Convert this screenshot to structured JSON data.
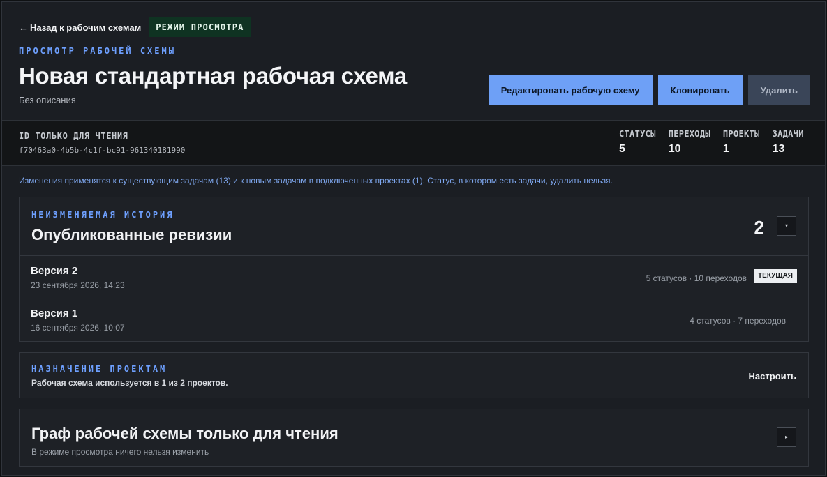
{
  "header": {
    "back_label": "Назад к рабочим схемам",
    "back_arrow": "←",
    "mode_badge": "РЕЖИМ ПРОСМОТРА",
    "eyebrow": "ПРОСМОТР РАБОЧЕЙ СХЕМЫ",
    "title": "Новая стандартная рабочая схема",
    "description": "Без описания",
    "actions": {
      "edit": "Редактировать рабочую схему",
      "clone": "Клонировать",
      "delete": "Удалить"
    }
  },
  "id_bar": {
    "label": "ID ТОЛЬКО ДЛЯ ЧТЕНИЯ",
    "value": "f70463a0-4b5b-4c1f-bc91-961340181990",
    "stats": [
      {
        "label": "СТАТУСЫ",
        "value": "5"
      },
      {
        "label": "ПЕРЕХОДЫ",
        "value": "10"
      },
      {
        "label": "ПРОЕКТЫ",
        "value": "1"
      },
      {
        "label": "ЗАДАЧИ",
        "value": "13"
      }
    ]
  },
  "notice": "Изменения применятся к существующим задачам (13) и к новым задачам в подключенных проектах (1). Статус, в котором есть задачи, удалить нельзя.",
  "revisions": {
    "eyebrow": "НЕИЗМЕНЯЕМАЯ ИСТОРИЯ",
    "title": "Опубликованные ревизии",
    "count": "2",
    "toggle_glyph": "▾",
    "items": [
      {
        "name": "Версия 2",
        "date": "23 сентября 2026, 14:23",
        "meta": "5 статусов · 10 переходов",
        "badge": "ТЕКУЩАЯ"
      },
      {
        "name": "Версия 1",
        "date": "16 сентября 2026, 10:07",
        "meta": "4 статусов · 7 переходов"
      }
    ]
  },
  "assignment": {
    "eyebrow": "НАЗНАЧЕНИЕ ПРОЕКТАМ",
    "text": "Рабочая схема используется в 1 из 2 проектов.",
    "action": "Настроить"
  },
  "graph": {
    "title": "Граф рабочей схемы только для чтения",
    "description": "В режиме просмотра ничего нельзя изменить",
    "toggle_glyph": "▸"
  },
  "colors": {
    "accent": "#6ea0f6",
    "eyebrow": "#6ea0ff",
    "badge_bg": "#0f3322",
    "background": "#1b1e23"
  }
}
